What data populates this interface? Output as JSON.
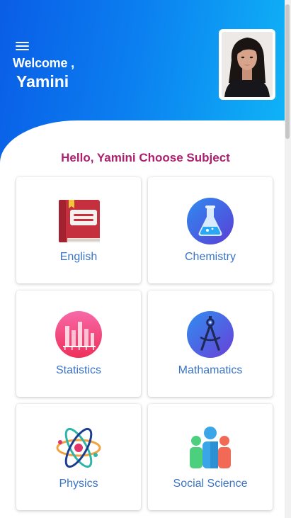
{
  "header": {
    "welcome_text": "Welcome ,",
    "user_name": "Yamini"
  },
  "greeting": "Hello, Yamini Choose Subject",
  "subjects": [
    {
      "label": "English",
      "icon": "book-icon"
    },
    {
      "label": "Chemistry",
      "icon": "flask-icon"
    },
    {
      "label": "Statistics",
      "icon": "bar-chart-icon"
    },
    {
      "label": "Mathamatics",
      "icon": "compass-icon"
    },
    {
      "label": "Physics",
      "icon": "atom-icon"
    },
    {
      "label": "Social Science",
      "icon": "people-icon"
    }
  ],
  "colors": {
    "header_gradient_start": "#0a5de6",
    "header_gradient_end": "#10b7f7",
    "greeting": "#ad1f6f",
    "subject_label": "#3a74c5"
  }
}
